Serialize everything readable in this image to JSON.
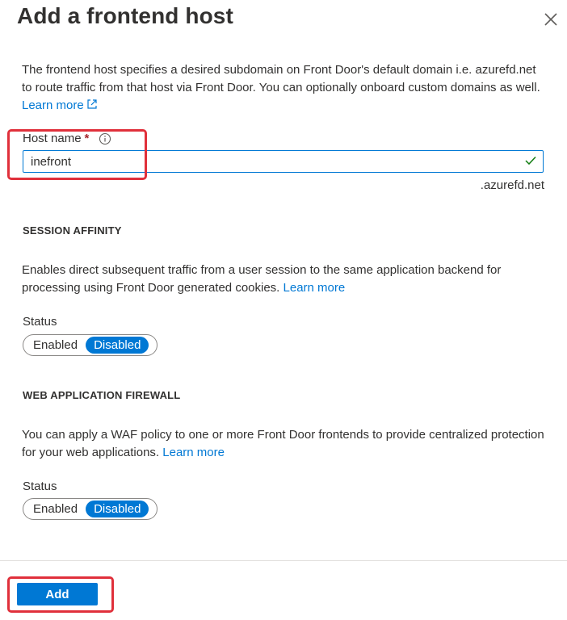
{
  "panel": {
    "title": "Add a frontend host",
    "close_icon": "close-icon",
    "description": "The frontend host specifies a desired subdomain on Front Door's default domain i.e. azurefd.net to route traffic from that host via Front Door. You can optionally onboard custom domains as well.",
    "learn_more": "Learn more"
  },
  "host_name": {
    "label": "Host name",
    "required_mark": "*",
    "value": "inefront",
    "suffix": ".azurefd.net",
    "valid": true
  },
  "session_affinity": {
    "heading": "SESSION AFFINITY",
    "description": "Enables direct subsequent traffic from a user session to the same application backend for processing using Front Door generated cookies.",
    "learn_more": "Learn more",
    "status_label": "Status",
    "options": [
      "Enabled",
      "Disabled"
    ],
    "selected": "Disabled"
  },
  "waf": {
    "heading": "WEB APPLICATION FIREWALL",
    "description": "You can apply a WAF policy to one or more Front Door frontends to provide centralized protection for your web applications.",
    "learn_more": "Learn more",
    "status_label": "Status",
    "options": [
      "Enabled",
      "Disabled"
    ],
    "selected": "Disabled"
  },
  "footer": {
    "add_label": "Add"
  },
  "colors": {
    "accent": "#0078d4",
    "highlight": "#e0303b",
    "valid": "#107c10"
  }
}
